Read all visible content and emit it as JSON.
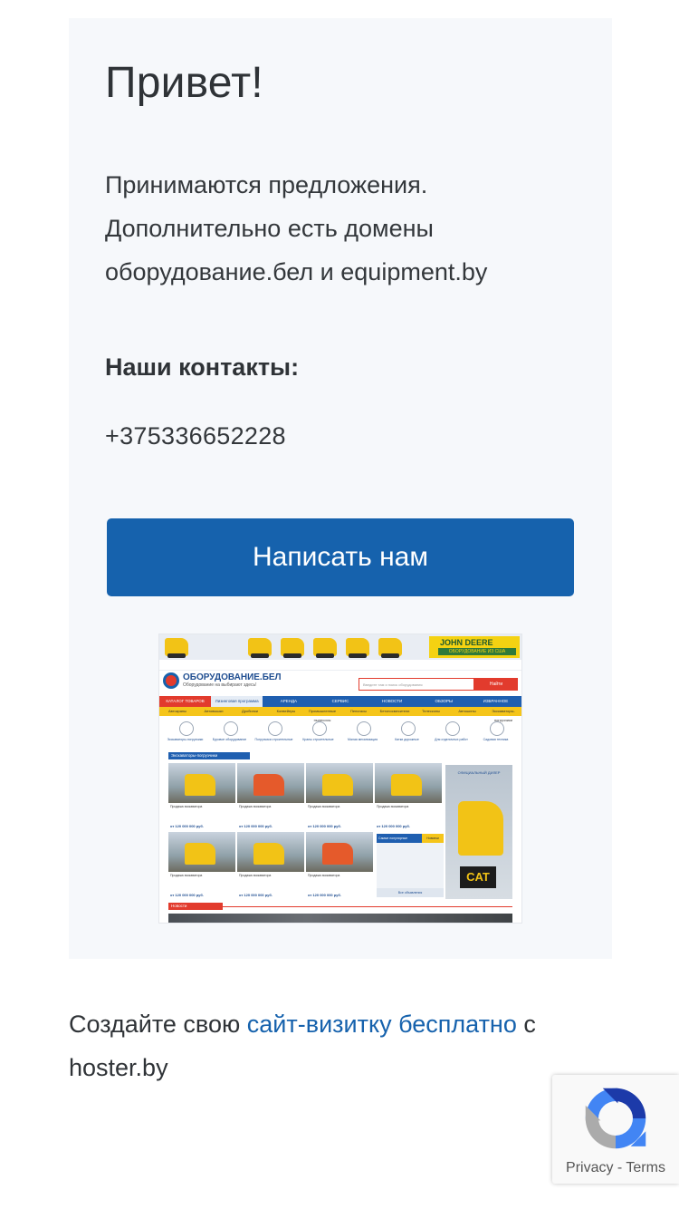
{
  "card": {
    "title": "Привет!",
    "lead": "Принимаются предложения. Дополнительно есть домены оборудование.бел и equipment.by",
    "contacts_heading": "Наши контакты:",
    "phone": "+375336652228",
    "cta_label": "Написать нам"
  },
  "site_preview": {
    "banner_brand": "JOHN DEERE",
    "banner_tagline": "ОБОРУДОВАНИЕ ИЗ США",
    "logo_name": "ОБОРУДОВАНИЕ.БЕЛ",
    "logo_tagline": "Оборудование на выбирают здесь!",
    "search_placeholder": "Введите там и поиск оборудования",
    "search_button": "Найти",
    "nav_main": [
      "КАТАЛОГ ТОВАРОВ",
      "Лизинговая программа",
      "АРЕНДА",
      "СЕРВИС",
      "НОВОСТИ",
      "ОБЗОРЫ",
      "ИЗБРАННОЕ"
    ],
    "nav_secondary": [
      "Автокраны",
      "Автовышки",
      "Дробилки",
      "Конвейеры",
      "Промышленные пылесосы",
      "Пеногасы",
      "Бетоносмесители",
      "Телескопы",
      "Автошины",
      "Экскаваторы-погрузчики"
    ],
    "categories": [
      "Экскаваторы-погрузчики",
      "Буровое оборудование",
      "Погрузчики строительные",
      "Краны строительные",
      "Малая механизация",
      "Катки дорожные",
      "Для отделочных работ",
      "Садовая техника"
    ],
    "section_title": "Экскаваторы-погрузчики",
    "products": [
      {
        "title": "Продажа экскаватора",
        "price": "от 120 000 000 руб."
      },
      {
        "title": "Продажа экскаватора",
        "price": "от 120 000 000 руб."
      },
      {
        "title": "Продажа экскаватора",
        "price": "от 120 000 000 руб."
      },
      {
        "title": "Продажа экскаватора",
        "price": "от 120 000 000 руб."
      },
      {
        "title": "Продажа экскаватора",
        "price": "от 120 000 000 руб."
      },
      {
        "title": "Продажа экскаватора",
        "price": "от 120 000 000 руб."
      },
      {
        "title": "Продажа экскаватора",
        "price": "от 120 000 000 руб."
      }
    ],
    "dealer_text": "ОФИЦИАЛЬНЫЙ ДИЛЕР",
    "side_brand": "CAT",
    "adbox_title": "Самые популярные",
    "adbox_tag": "Новинки",
    "adbox_footer": "Все объявления",
    "news_title": "Новости"
  },
  "footer": {
    "prefix": "Создайте свою",
    "link": "сайт-визитку бесплатно",
    "suffix": "с hoster.by"
  },
  "recaptcha": {
    "privacy": "Privacy",
    "separator": "-",
    "terms": "Terms"
  }
}
